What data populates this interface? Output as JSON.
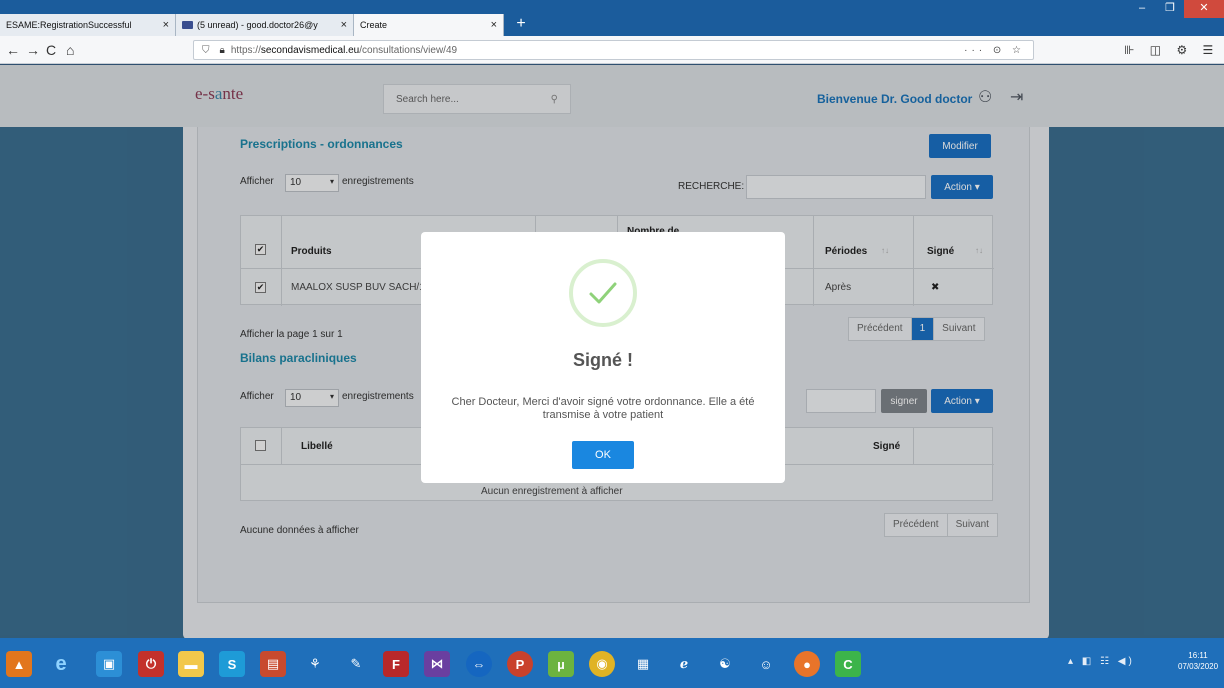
{
  "browser": {
    "tabs": [
      {
        "label": "ESAME:RegistrationSuccessful",
        "close": "×"
      },
      {
        "label": "(5 unread) - good.doctor26@y",
        "close": "×"
      },
      {
        "label": "Create",
        "close": "×"
      }
    ],
    "new_tab": "+",
    "url_prefix": "https://",
    "url_host": "secondavismedical.eu",
    "url_path": "/consultations/view/49",
    "url_right_icons": "··· ⊙ ☆",
    "nav": {
      "back": "←",
      "forward": "→",
      "reload": "C",
      "home": "⌂"
    },
    "toolbar_icons": "⊪ ◫ ⚙ ☰",
    "window_buttons": {
      "min": "–",
      "max": "❐",
      "close": "✕"
    }
  },
  "header": {
    "logo_a": "e-s",
    "logo_b": "a",
    "logo_c": "nte",
    "search_placeholder": "Search here...",
    "search_icon": "search-icon",
    "welcome": "Bienvenue Dr. Good doctor",
    "user_icon": "user-icon",
    "logout_icon": "logout-icon"
  },
  "prescriptions": {
    "title": "Prescriptions - ordonnances",
    "modify_label": "Modifier",
    "show_label": "Afficher",
    "show_value": "10",
    "records_label": "enregistrements",
    "search_label": "RECHERCHE:",
    "action_label": "Action ▾",
    "columns": [
      "Produits",
      "Nombre de",
      "Périodes",
      "Signé"
    ],
    "sort_glyph": "↑↓",
    "rows": [
      {
        "product": "MAALOX SUSP BUV SACH/1",
        "period": "Après",
        "signed": "✖"
      }
    ],
    "page_info": "Afficher la page 1 sur 1",
    "prev": "Précédent",
    "current_page": "1",
    "next": "Suivant"
  },
  "bilans": {
    "title": "Bilans paracliniques",
    "show_label": "Afficher",
    "show_value": "10",
    "records_label": "enregistrements",
    "sign_label": "signer",
    "action_label": "Action ▾",
    "columns": [
      "Libellé",
      "Signé"
    ],
    "empty_row": "Aucun enregistrement à afficher",
    "no_data": "Aucune données à afficher",
    "prev": "Précédent",
    "next": "Suivant"
  },
  "modal": {
    "icon": "check-icon",
    "title": "Signé !",
    "message": "Cher Docteur, Merci d'avoir signé votre ordonnance. Elle a été transmise à votre patient",
    "ok_label": "OK",
    "accent_color": "#1a87e0",
    "check_color": "#8fd27a"
  },
  "taskbar": {
    "icons": [
      "vlc-icon",
      "ie-icon",
      "app-icon",
      "office-icon",
      "folder-icon",
      "skype-icon",
      "media-icon",
      "network-icon",
      "tool-icon",
      "filezilla-icon",
      "vs-icon",
      "teamviewer-icon",
      "powerpoint-icon",
      "utorrent-icon",
      "chrome-icon",
      "notes-icon",
      "edge-icon",
      "gimp-icon",
      "people-icon",
      "firefox-icon",
      "green-app-icon"
    ],
    "tray": "▴ ◧ ☷ ◀) ",
    "time": "16:11",
    "date": "07/03/2020"
  }
}
